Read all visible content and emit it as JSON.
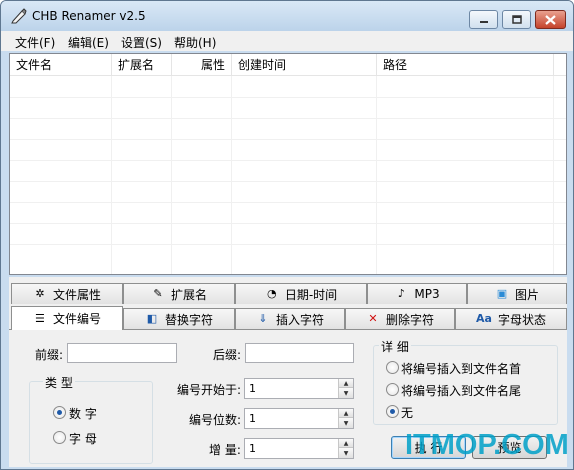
{
  "window": {
    "title": "CHB Renamer v2.5"
  },
  "menu": [
    "文件(F)",
    "编辑(E)",
    "设置(S)",
    "帮助(H)"
  ],
  "file_list": {
    "columns": [
      "文件名",
      "扩展名",
      "属性",
      "创建时间",
      "路径"
    ]
  },
  "tabs_row1": [
    {
      "label": "文件属性",
      "icon": "gear-icon"
    },
    {
      "label": "扩展名",
      "icon": "edit-icon"
    },
    {
      "label": "日期-时间",
      "icon": "clock-icon"
    },
    {
      "label": "MP3",
      "icon": "music-icon"
    },
    {
      "label": "图片",
      "icon": "image-icon"
    }
  ],
  "tabs_row2": [
    {
      "label": "文件编号",
      "icon": "list-icon",
      "active": true
    },
    {
      "label": "替换字符",
      "icon": "replace-icon"
    },
    {
      "label": "插入字符",
      "icon": "insert-icon"
    },
    {
      "label": "删除字符",
      "icon": "delete-icon"
    },
    {
      "label": "字母状态",
      "icon": "letter-case-icon",
      "icon_text": "Aa"
    }
  ],
  "numbering": {
    "prefix_label": "前缀:",
    "prefix_value": "",
    "suffix_label": "后缀:",
    "suffix_value": "",
    "type_group": "类 型",
    "type_options": [
      "数 字",
      "字 母"
    ],
    "type_selected": "数 字",
    "start_label": "编号开始于:",
    "start_value": "1",
    "digits_label": "编号位数:",
    "digits_value": "1",
    "increment_label": "增 量:",
    "increment_value": "1",
    "detail_group": "详 细",
    "detail_options": [
      "将编号插入到文件名首",
      "将编号插入到文件名尾",
      "无"
    ],
    "detail_selected": "无"
  },
  "buttons": {
    "execute": "执 行",
    "preview": "预览"
  },
  "watermark": "ITMOP.COM"
}
